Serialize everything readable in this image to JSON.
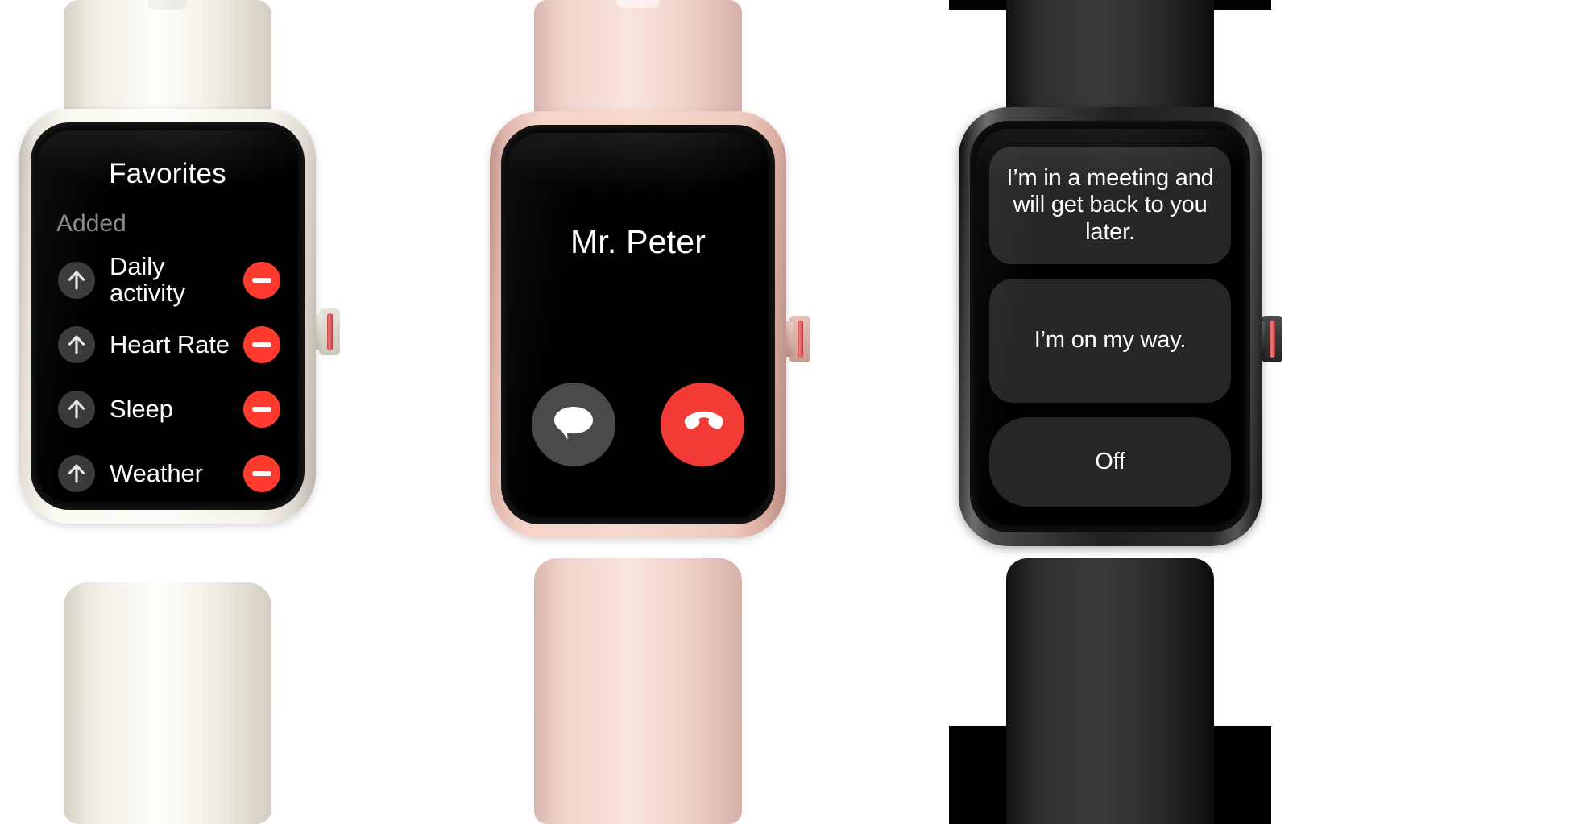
{
  "scene": {
    "description": "Three smartwatch product renders side by side",
    "background_color": "#ffffff"
  },
  "watches": [
    {
      "id": "watch-favorites",
      "case_color": "#fdfcf8",
      "case_color_name": "Starlight",
      "band_color": "#fffefa",
      "screen": {
        "type": "favorites-list",
        "title": "Favorites",
        "section_header": "Added",
        "items": [
          {
            "label": "Daily activity",
            "reorder_icon": "arrow-up-icon",
            "remove_icon": "minus-icon"
          },
          {
            "label": "Heart Rate",
            "reorder_icon": "arrow-up-icon",
            "remove_icon": "minus-icon"
          },
          {
            "label": "Sleep",
            "reorder_icon": "arrow-up-icon",
            "remove_icon": "minus-icon"
          },
          {
            "label": "Weather",
            "reorder_icon": "arrow-up-icon",
            "remove_icon": "minus-icon"
          }
        ],
        "accent_remove_color": "#ff3b30",
        "reorder_chip_color": "#3a3a3c",
        "section_header_color": "#8a8a8e"
      }
    },
    {
      "id": "watch-incoming-call",
      "case_color": "#f7d8cd",
      "case_color_name": "Pink",
      "band_color": "#fae4de",
      "screen": {
        "type": "incoming-call",
        "caller_name": "Mr. Peter",
        "actions": [
          {
            "name": "message",
            "icon": "message-bubble-icon",
            "color": "#4a4a4a"
          },
          {
            "name": "decline",
            "icon": "phone-hangup-icon",
            "color": "#f23b36"
          }
        ]
      }
    },
    {
      "id": "watch-quick-replies",
      "case_color": "#202020",
      "case_color_name": "Graphite",
      "band_color": "#2b2b2b",
      "screen": {
        "type": "quick-reply-list",
        "button_color": "#262626",
        "replies": [
          {
            "label": "I’m in a meeting and will get back to you later."
          },
          {
            "label": "I’m on my way."
          },
          {
            "label": "Off"
          }
        ]
      }
    }
  ]
}
